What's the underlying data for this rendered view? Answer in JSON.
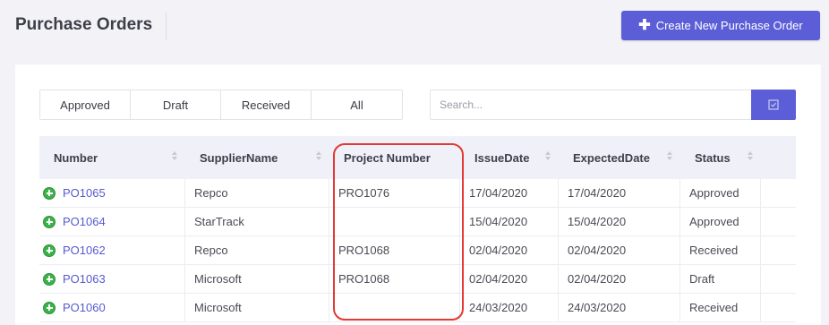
{
  "header": {
    "title": "Purchase Orders",
    "create_button_label": "Create New Purchase Order",
    "create_button_icon": "plus-icon"
  },
  "filters": {
    "tabs": [
      "Approved",
      "Draft",
      "Received",
      "All"
    ],
    "search": {
      "placeholder": "Search...",
      "value": ""
    },
    "search_button_icon": "search-icon"
  },
  "table": {
    "columns": [
      "Number",
      "SupplierName",
      "Project Number",
      "IssueDate",
      "ExpectedDate",
      "Status"
    ],
    "rows": [
      {
        "number": "PO1065",
        "supplier": "Repco",
        "project": "PRO1076",
        "issue": "17/04/2020",
        "expected": "17/04/2020",
        "status": "Approved"
      },
      {
        "number": "PO1064",
        "supplier": "StarTrack",
        "project": "",
        "issue": "15/04/2020",
        "expected": "15/04/2020",
        "status": "Approved"
      },
      {
        "number": "PO1062",
        "supplier": "Repco",
        "project": "PRO1068",
        "issue": "02/04/2020",
        "expected": "02/04/2020",
        "status": "Received"
      },
      {
        "number": "PO1063",
        "supplier": "Microsoft",
        "project": "PRO1068",
        "issue": "02/04/2020",
        "expected": "02/04/2020",
        "status": "Draft"
      },
      {
        "number": "PO1060",
        "supplier": "Microsoft",
        "project": "",
        "issue": "24/03/2020",
        "expected": "24/03/2020",
        "status": "Received"
      }
    ]
  },
  "colors": {
    "accent": "#5b5ed6",
    "link": "#5659d0",
    "expand_icon": "#3cb34a",
    "annotation": "#e23a34"
  }
}
